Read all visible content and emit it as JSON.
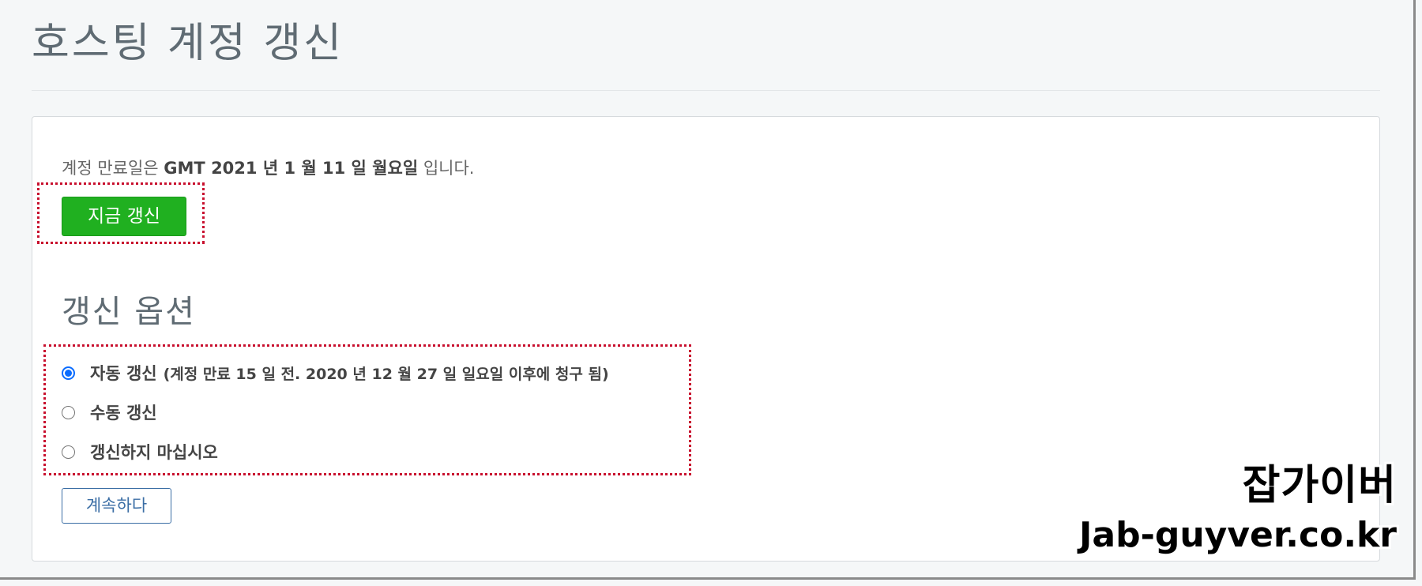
{
  "page": {
    "title": "호스팅 계정 갱신"
  },
  "expiry": {
    "prefix": "계정 만료일은",
    "date": "GMT 2021 년 1 월 11 일 월요일",
    "suffix": "입니다."
  },
  "renew_button_label": "지금 갱신",
  "options_section": {
    "title": "갱신 옵션",
    "options": [
      {
        "label": "자동 갱신",
        "detail": "(계정 만료 15 일 전. 2020 년 12 월 27 일 일요일 이후에 청구 됨)",
        "selected": true
      },
      {
        "label": "수동 갱신",
        "detail": "",
        "selected": false
      },
      {
        "label": "갱신하지 마십시오",
        "detail": "",
        "selected": false
      }
    ]
  },
  "continue_button_label": "계속하다",
  "watermark": {
    "korean": "잡가이버",
    "url": "Jab-guyver.co.kr"
  },
  "colors": {
    "renew_button": "#20b020",
    "highlight_border": "#c8102e",
    "radio_selected": "#0a6cff",
    "continue_button_border": "#3b6ea5"
  }
}
